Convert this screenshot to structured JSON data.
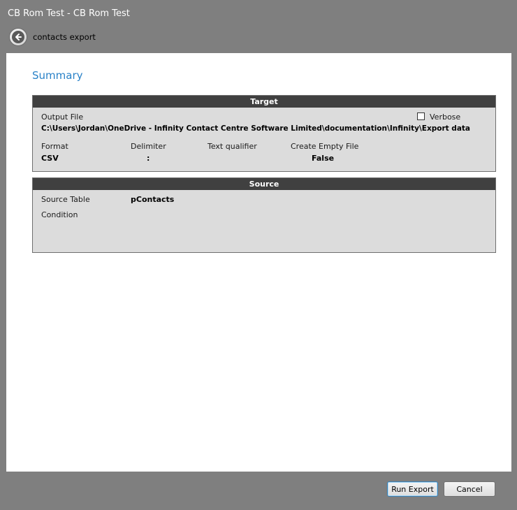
{
  "window": {
    "title": "CB Rom Test - CB Rom Test"
  },
  "nav": {
    "back_icon": "back-arrow-icon",
    "page_name": "contacts export"
  },
  "summary": {
    "heading": "Summary"
  },
  "target": {
    "header": "Target",
    "output_file_label": "Output File",
    "output_file_value": "C:\\Users\\Jordan\\OneDrive - Infinity Contact Centre Software Limited\\documentation\\Infinity\\Export data",
    "verbose_label": "Verbose",
    "verbose_checked": false,
    "format_label": "Format",
    "format_value": "CSV",
    "delimiter_label": "Delimiter",
    "delimiter_value": ":",
    "text_qualifier_label": "Text qualifier",
    "text_qualifier_value": "",
    "create_empty_file_label": "Create Empty File",
    "create_empty_file_value": "False"
  },
  "source": {
    "header": "Source",
    "source_table_label": "Source Table",
    "source_table_value": "pContacts",
    "condition_label": "Condition",
    "condition_value": ""
  },
  "buttons": {
    "run_export": "Run Export",
    "cancel": "Cancel"
  },
  "colors": {
    "frame": "#7f7f7f",
    "accent": "#2a82c8",
    "panel_header": "#404040",
    "panel_body": "#dcdcdc"
  }
}
